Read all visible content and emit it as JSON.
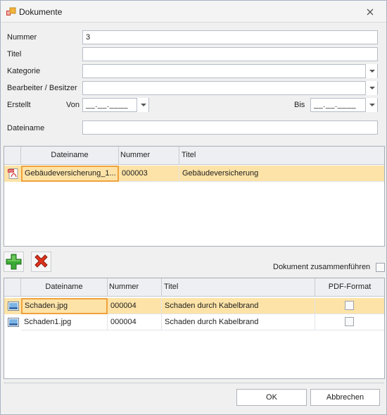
{
  "window": {
    "title": "Dokumente",
    "app_icon": "document-app-icon",
    "close_icon": "close-icon"
  },
  "form": {
    "nummer_label": "Nummer",
    "nummer_value": "3",
    "titel_label": "Titel",
    "titel_value": "",
    "kategorie_label": "Kategorie",
    "kategorie_value": "",
    "bearbeiter_label": "Bearbeiter / Besitzer",
    "bearbeiter_value": "",
    "erstellt_label": "Erstellt",
    "von_label": "Von",
    "von_value": "__.__.____",
    "bis_label": "Bis",
    "bis_value": "__.__.____",
    "dateiname_label": "Dateiname",
    "dateiname_value": ""
  },
  "documents_grid": {
    "columns": [
      "Dateiname",
      "Nummer",
      "Titel"
    ],
    "rows": [
      {
        "icon": "pdf-file-icon",
        "dateiname": "Gebäudeversicherung_1...",
        "nummer": "000003",
        "titel": "Gebäudeversicherung",
        "selected": true
      }
    ]
  },
  "toolbar": {
    "add_icon": "add-plus-icon",
    "delete_icon": "delete-x-icon",
    "merge_label": "Dokument zusammenführen",
    "merge_checked": false
  },
  "files_grid": {
    "columns": [
      "Dateiname",
      "Nummer",
      "Titel",
      "PDF-Format"
    ],
    "rows": [
      {
        "icon": "image-file-icon",
        "dateiname": "Schaden.jpg",
        "nummer": "000004",
        "titel": "Schaden durch Kabelbrand",
        "pdf": false,
        "selected": true
      },
      {
        "icon": "image-file-icon",
        "dateiname": "Schaden1.jpg",
        "nummer": "000004",
        "titel": "Schaden durch Kabelbrand",
        "pdf": false,
        "selected": false
      }
    ]
  },
  "buttons": {
    "ok": "OK",
    "cancel": "Abbrechen"
  },
  "colors": {
    "selection": "#fde3a7",
    "focus_border": "#f0a23c",
    "add_green": "#3aa935",
    "delete_red": "#e0321c"
  }
}
